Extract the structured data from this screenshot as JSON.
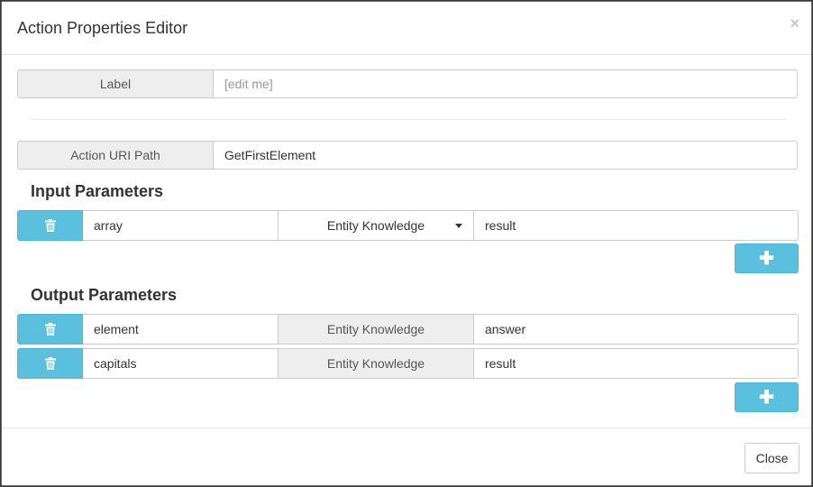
{
  "dialog": {
    "title": "Action Properties Editor",
    "close_symbol": "×"
  },
  "label_field": {
    "label": "Label",
    "placeholder": "[edit me]",
    "value": ""
  },
  "uri_field": {
    "label": "Action URI Path",
    "value": "GetFirstElement"
  },
  "input_parameters": {
    "title": "Input Parameters",
    "rows": [
      {
        "name": "array",
        "type": "Entity Knowledge",
        "value": "result"
      }
    ],
    "add_symbol": "✚"
  },
  "output_parameters": {
    "title": "Output Parameters",
    "rows": [
      {
        "name": "element",
        "type": "Entity Knowledge",
        "value": "answer"
      },
      {
        "name": "capitals",
        "type": "Entity Knowledge",
        "value": "result"
      }
    ],
    "add_symbol": "✚"
  },
  "footer": {
    "close_label": "Close"
  },
  "colors": {
    "info_button": "#5bc0de",
    "addon_bg": "#eeeeee"
  },
  "icons": {
    "delete": "trash-icon",
    "add": "plus-icon",
    "dropdown": "caret-down-icon"
  }
}
